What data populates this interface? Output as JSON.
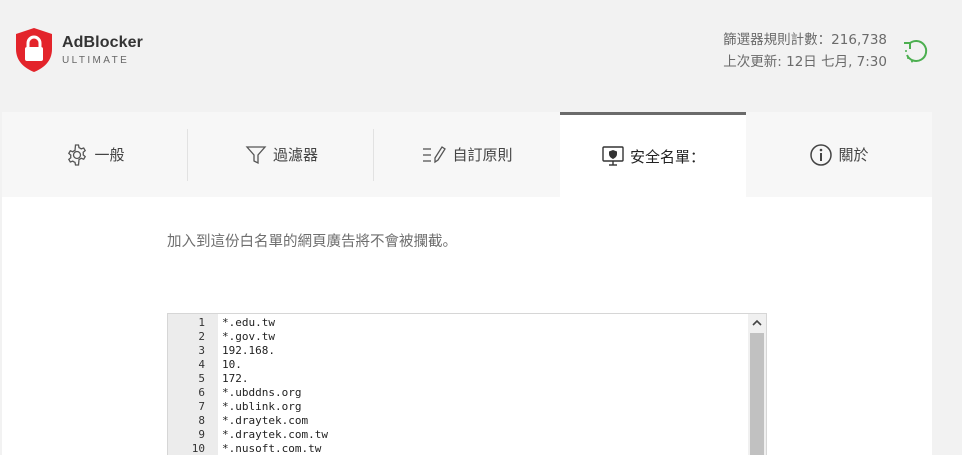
{
  "app": {
    "name": "AdBlocker",
    "subtitle": "ULTIMATE",
    "logo_color": "#e3242b"
  },
  "stats": {
    "rules_count": "篩選器規則計數：216,738",
    "last_update": "上次更新: 12日 七月, 7:30"
  },
  "refresh_icon": "refresh-icon",
  "accent_green": "#4caf50",
  "tabs": [
    {
      "label": "一般",
      "icon": "gear-icon"
    },
    {
      "label": "過濾器",
      "icon": "filter-icon"
    },
    {
      "label": "自訂原則",
      "icon": "edit-list-icon"
    },
    {
      "label": "安全名單：",
      "icon": "shield-monitor-icon",
      "active": true
    },
    {
      "label": "關於",
      "icon": "info-icon"
    }
  ],
  "whitelist": {
    "description": "加入到這份白名單的網頁廣告將不會被攔截。",
    "lines": [
      {
        "n": "1",
        "text": "*.edu.tw"
      },
      {
        "n": "2",
        "text": "*.gov.tw"
      },
      {
        "n": "3",
        "text": "192.168."
      },
      {
        "n": "4",
        "text": "10."
      },
      {
        "n": "5",
        "text": "172."
      },
      {
        "n": "6",
        "text": "*.ubddns.org"
      },
      {
        "n": "7",
        "text": "*.ublink.org"
      },
      {
        "n": "8",
        "text": "*.draytek.com"
      },
      {
        "n": "9",
        "text": "*.draytek.com.tw"
      },
      {
        "n": "10",
        "text": "*.nusoft.com.tw"
      }
    ]
  }
}
